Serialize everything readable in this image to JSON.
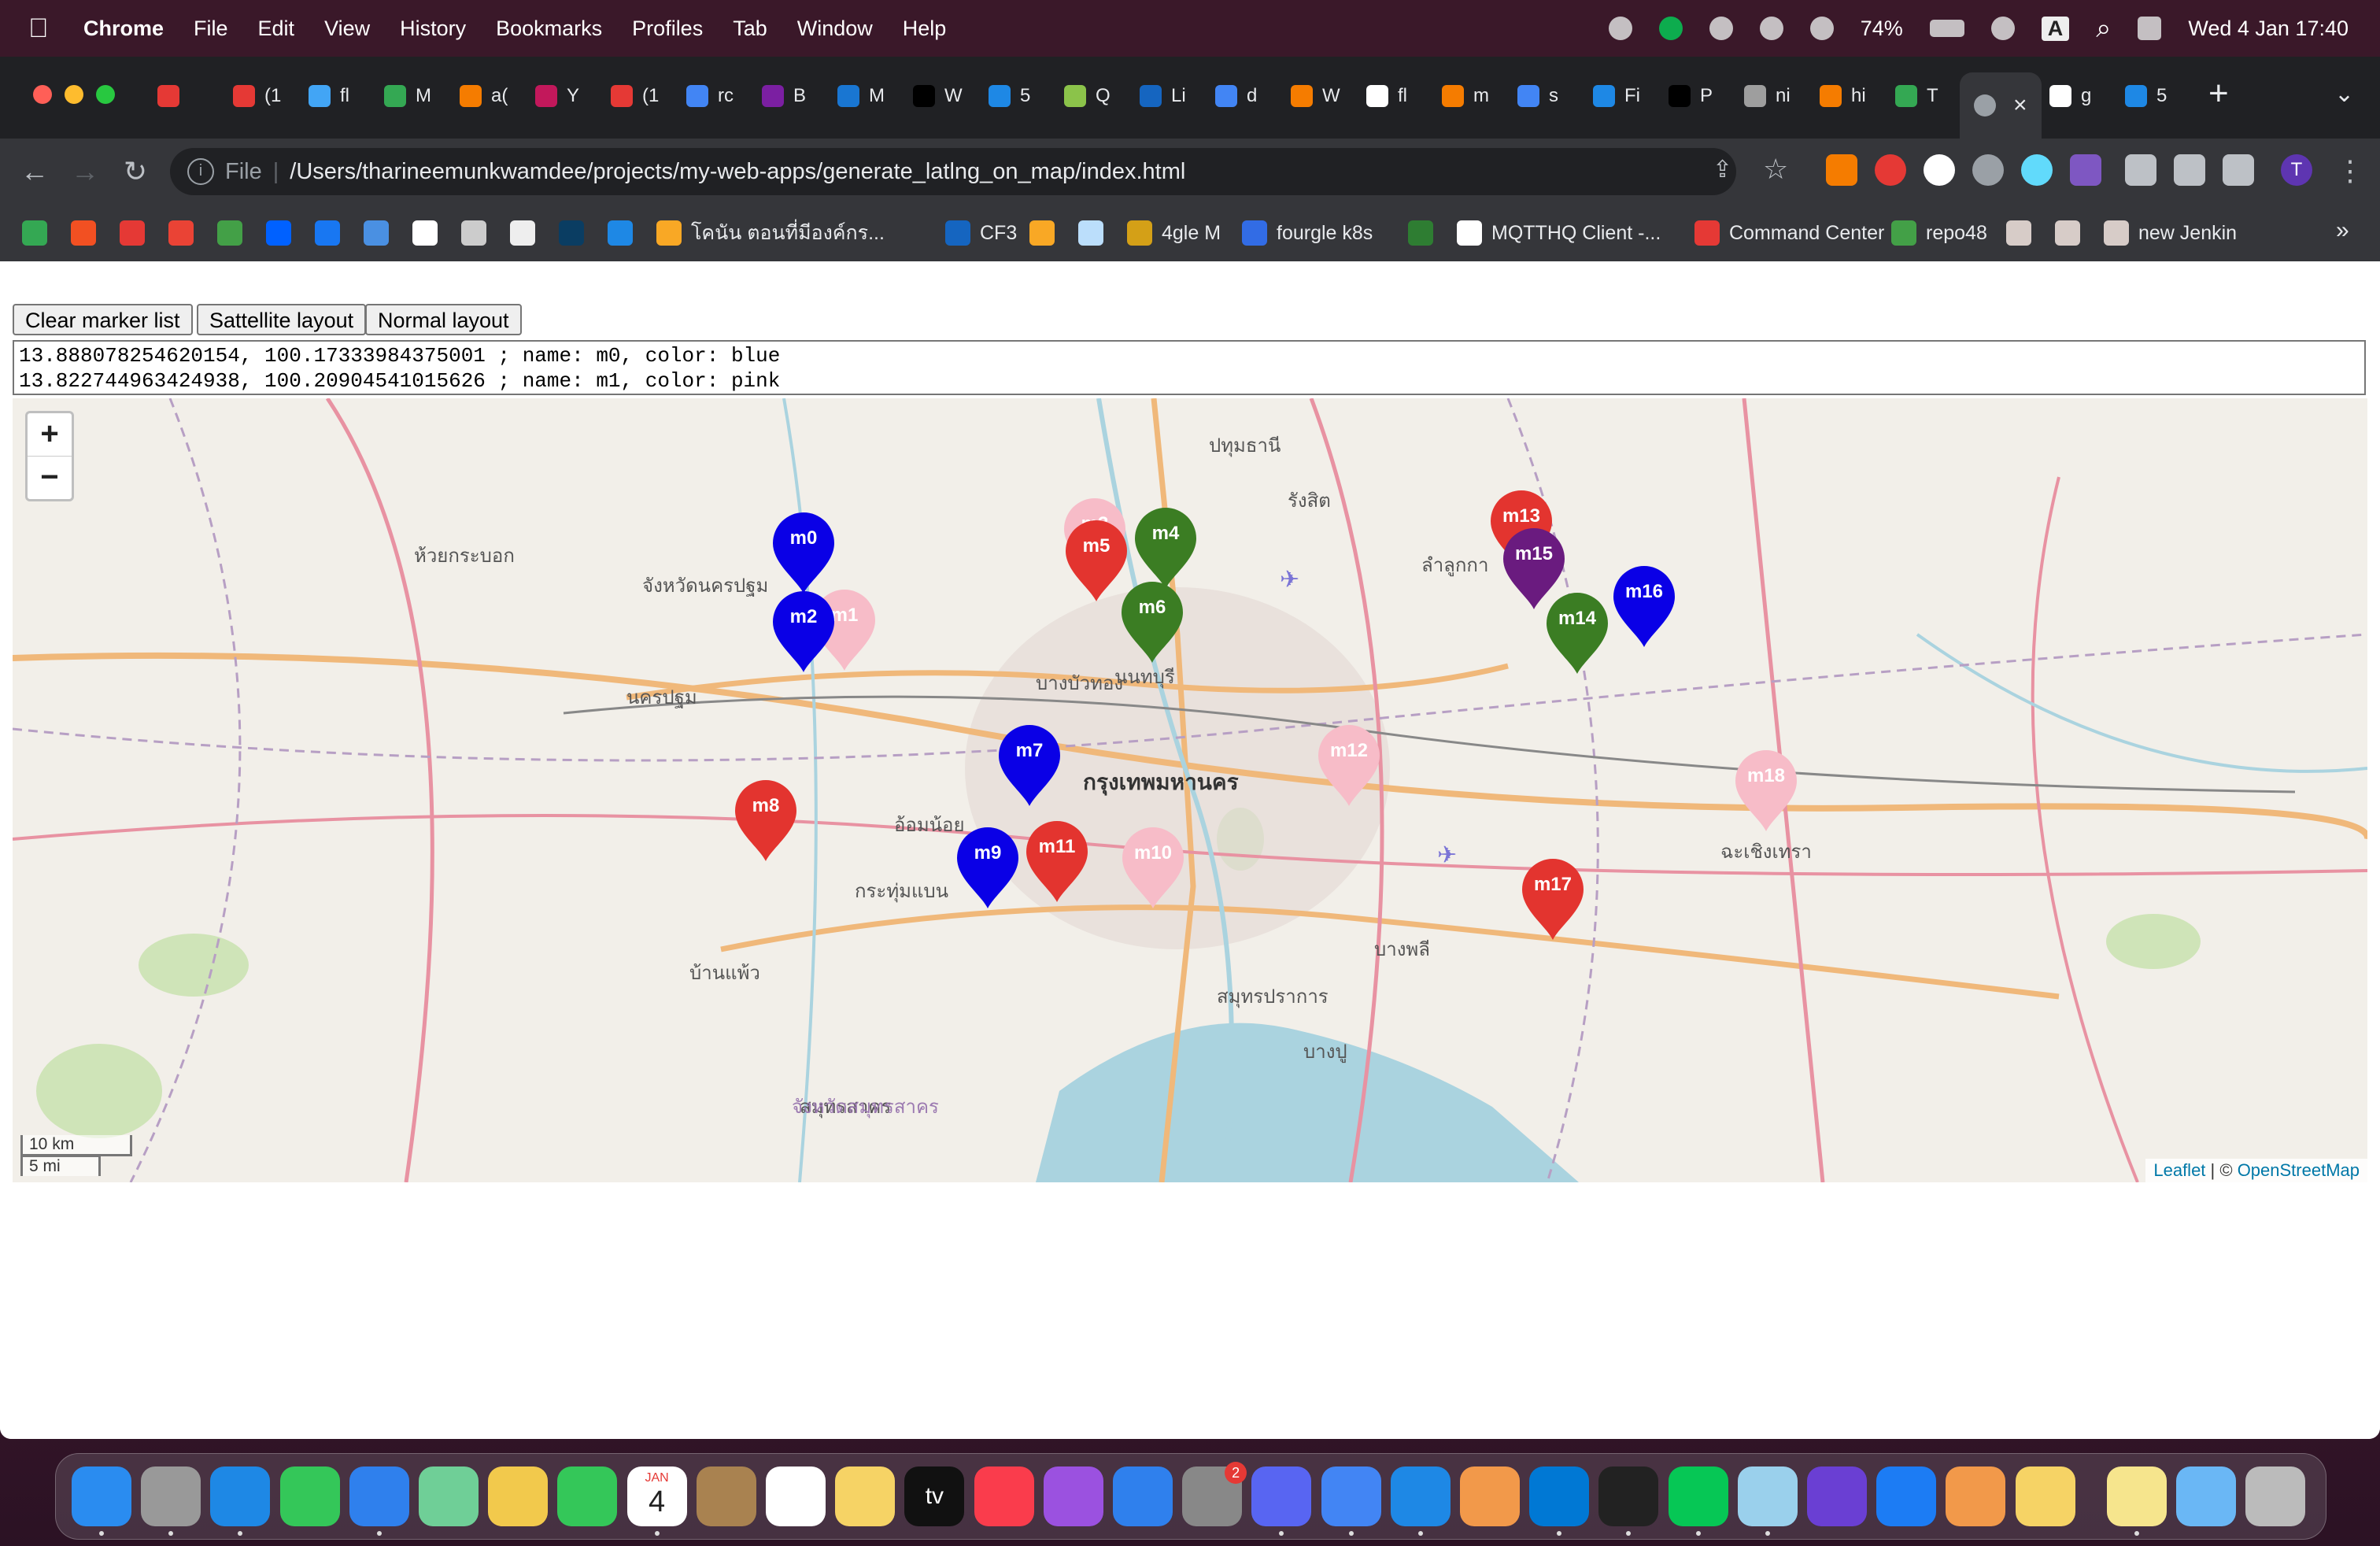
{
  "menubar": {
    "app": "Chrome",
    "items": [
      "File",
      "Edit",
      "View",
      "History",
      "Bookmarks",
      "Profiles",
      "Tab",
      "Window",
      "Help"
    ],
    "battery": "74%",
    "datetime": "Wed 4 Jan  17:40",
    "input_source": "A"
  },
  "browser": {
    "tabs": [
      {
        "label": "",
        "color": "#e53935"
      },
      {
        "label": "(1",
        "color": "#e53935"
      },
      {
        "label": "fl",
        "color": "#42a5f5"
      },
      {
        "label": "M",
        "color": "#34a853"
      },
      {
        "label": "a(",
        "color": "#f57c00"
      },
      {
        "label": "Y",
        "color": "#c2185b"
      },
      {
        "label": "(1",
        "color": "#e53935"
      },
      {
        "label": "rc",
        "color": "#4285f4"
      },
      {
        "label": "B",
        "color": "#7b1fa2"
      },
      {
        "label": "M",
        "color": "#1976d2"
      },
      {
        "label": "W",
        "color": "#000000"
      },
      {
        "label": "5",
        "color": "#1e88e5"
      },
      {
        "label": "Q",
        "color": "#8bc34a"
      },
      {
        "label": "Li",
        "color": "#1565c0"
      },
      {
        "label": "d",
        "color": "#4285f4"
      },
      {
        "label": "W",
        "color": "#f57c00"
      },
      {
        "label": "fl",
        "color": "#ffffff"
      },
      {
        "label": "m",
        "color": "#f57c00"
      },
      {
        "label": "s",
        "color": "#4285f4"
      },
      {
        "label": "Fi",
        "color": "#1e88e5"
      },
      {
        "label": "P",
        "color": "#000000"
      },
      {
        "label": "ni",
        "color": "#9e9e9e"
      },
      {
        "label": "hi",
        "color": "#f57c00"
      },
      {
        "label": "T",
        "color": "#34a853"
      }
    ],
    "active_tab": {
      "label": "",
      "color": "#9aa0a6"
    },
    "tabs_after": [
      {
        "label": "g",
        "color": "#ffffff"
      },
      {
        "label": "5",
        "color": "#1e88e5"
      }
    ],
    "address": {
      "scheme": "File",
      "url": "/Users/tharineemunkwamdee/projects/my-web-apps/generate_latlng_on_map/index.html"
    },
    "bookmarks": [
      {
        "label": "",
        "color": "#34a853"
      },
      {
        "label": "",
        "color": "#f25022"
      },
      {
        "label": "",
        "color": "#e53935"
      },
      {
        "label": "",
        "color": "#ea4335"
      },
      {
        "label": "",
        "color": "#43a047"
      },
      {
        "label": "",
        "color": "#0061ff"
      },
      {
        "label": "",
        "color": "#1877f2"
      },
      {
        "label": "",
        "color": "#4a90e2"
      },
      {
        "label": "",
        "color": "#ffffff"
      },
      {
        "label": "",
        "color": "#cccccc"
      },
      {
        "label": "",
        "color": "#eeeeee"
      },
      {
        "label": "",
        "color": "#0a3d62"
      },
      {
        "label": "",
        "color": "#1e88e5"
      },
      {
        "label": "โคนัน ตอนที่มีองค์กร...",
        "color": "#f9a825"
      },
      {
        "label": "CF3",
        "color": "#1565c0"
      },
      {
        "label": "",
        "color": "#f9a825"
      },
      {
        "label": "",
        "color": "#bbdefb"
      },
      {
        "label": "4gle M",
        "color": "#d4a017"
      },
      {
        "label": "fourgle k8s",
        "color": "#326ce5"
      },
      {
        "label": "",
        "color": "#2e7d32"
      },
      {
        "label": "MQTTHQ Client -...",
        "color": "#ffffff"
      },
      {
        "label": "Command Center",
        "color": "#e53935"
      },
      {
        "label": "repo48",
        "color": "#43a047"
      },
      {
        "label": "",
        "color": "#d7ccc8"
      },
      {
        "label": "",
        "color": "#d7ccc8"
      },
      {
        "label": "new Jenkin",
        "color": "#d7ccc8"
      }
    ],
    "bookmarks_more": "»"
  },
  "page": {
    "buttons": {
      "clear": "Clear marker list",
      "satellite": "Sattellite layout",
      "normal": "Normal layout"
    },
    "textarea": "13.888078254620154, 100.17333984375001 ; name: m0, color: blue\n13.822744963424938, 100.20904541015626 ; name: m1, color: pink",
    "map": {
      "zoom_in": "+",
      "zoom_out": "−",
      "scale_km": "10 km",
      "scale_mi": "5 mi",
      "attribution_leaflet": "Leaflet",
      "attribution_sep": " | © ",
      "attribution_osm": "OpenStreetMap",
      "places": [
        {
          "name": "นครปฐม"
        },
        {
          "name": "จังหวัดนครปฐม"
        },
        {
          "name": "นนทบุรี"
        },
        {
          "name": "กรุงเทพมหานคร"
        },
        {
          "name": "รังสิต"
        },
        {
          "name": "สมุทรปราการ"
        },
        {
          "name": "สมุทรสาคร"
        },
        {
          "name": "จังหวัดสมุทรสาคร"
        },
        {
          "name": "อ้อมน้อย"
        },
        {
          "name": "กระทุ่มแบน"
        },
        {
          "name": "บางพลี"
        },
        {
          "name": "บางบัวทอง"
        },
        {
          "name": "ฉะเชิงเทรา"
        },
        {
          "name": "ลำลูกกา"
        },
        {
          "name": "บางปู"
        },
        {
          "name": "ปทุมธานี"
        },
        {
          "name": "ห้วยกระบอก"
        },
        {
          "name": "บ้านแพ้ว"
        }
      ],
      "markers": [
        {
          "name": "m3",
          "color": "#f7bcc8"
        },
        {
          "name": "m1",
          "color": "#f7bcc8"
        },
        {
          "name": "m0",
          "color": "#0a00e6"
        },
        {
          "name": "m2",
          "color": "#0a00e6"
        },
        {
          "name": "m5",
          "color": "#e3342f"
        },
        {
          "name": "m4",
          "color": "#3b7d23"
        },
        {
          "name": "m6",
          "color": "#3b7d23"
        },
        {
          "name": "m13",
          "color": "#e3342f"
        },
        {
          "name": "m15",
          "color": "#6a1b7f"
        },
        {
          "name": "m16",
          "color": "#0a00e6"
        },
        {
          "name": "m14",
          "color": "#3b7d23"
        },
        {
          "name": "m12",
          "color": "#f7bcc8"
        },
        {
          "name": "m18",
          "color": "#f7bcc8"
        },
        {
          "name": "m7",
          "color": "#0a00e6"
        },
        {
          "name": "m8",
          "color": "#e3342f"
        },
        {
          "name": "m9",
          "color": "#0a00e6"
        },
        {
          "name": "m11",
          "color": "#e3342f"
        },
        {
          "name": "m10",
          "color": "#f7bcc8"
        },
        {
          "name": "m17",
          "color": "#e3342f"
        }
      ]
    }
  },
  "dock": {
    "apps": [
      {
        "name": "finder-icon",
        "color": "#2a8cf0"
      },
      {
        "name": "launchpad-icon",
        "color": "#999999"
      },
      {
        "name": "safari-icon",
        "color": "#1e88e5"
      },
      {
        "name": "messages-icon",
        "color": "#34c759"
      },
      {
        "name": "mail-icon",
        "color": "#2f80ed"
      },
      {
        "name": "maps-icon",
        "color": "#6fcf97"
      },
      {
        "name": "photos-icon",
        "color": "#f2c94c"
      },
      {
        "name": "facetime-icon",
        "color": "#34c759"
      },
      {
        "name": "calendar-icon",
        "color": "#ffffff"
      },
      {
        "name": "contacts-icon",
        "color": "#a98250"
      },
      {
        "name": "reminders-icon",
        "color": "#ffffff"
      },
      {
        "name": "notes-icon",
        "color": "#f6d365"
      },
      {
        "name": "tv-icon",
        "color": "#111111"
      },
      {
        "name": "music-icon",
        "color": "#fa3c4c"
      },
      {
        "name": "podcasts-icon",
        "color": "#9b51e0"
      },
      {
        "name": "app-store-icon",
        "color": "#2f80ed"
      },
      {
        "name": "system-preferences-icon",
        "color": "#888888"
      },
      {
        "name": "discord-icon",
        "color": "#5865f2"
      },
      {
        "name": "chrome-icon",
        "color": "#4285f4"
      },
      {
        "name": "airmail-icon",
        "color": "#1e88e5"
      },
      {
        "name": "sourcetree-icon",
        "color": "#f2994a"
      },
      {
        "name": "vscode-icon",
        "color": "#0078d4"
      },
      {
        "name": "terminal-icon",
        "color": "#222222"
      },
      {
        "name": "line-icon",
        "color": "#06c755"
      },
      {
        "name": "preview-icon",
        "color": "#9ad0ec"
      },
      {
        "name": "eclipse-icon",
        "color": "#6a3fd3"
      },
      {
        "name": "xcode-icon",
        "color": "#1c7cf4"
      },
      {
        "name": "pages-icon",
        "color": "#f2994a"
      },
      {
        "name": "weather-icon",
        "color": "#f6d365"
      },
      {
        "name": "stickies-icon",
        "color": "#f6e58d"
      },
      {
        "name": "downloads-folder-icon",
        "color": "#6ab7f5"
      },
      {
        "name": "trash-icon",
        "color": "#bbbbbb"
      }
    ],
    "calendar_month": "JAN",
    "calendar_day": "4",
    "tv_label": "tv",
    "badge_settings": "2"
  }
}
